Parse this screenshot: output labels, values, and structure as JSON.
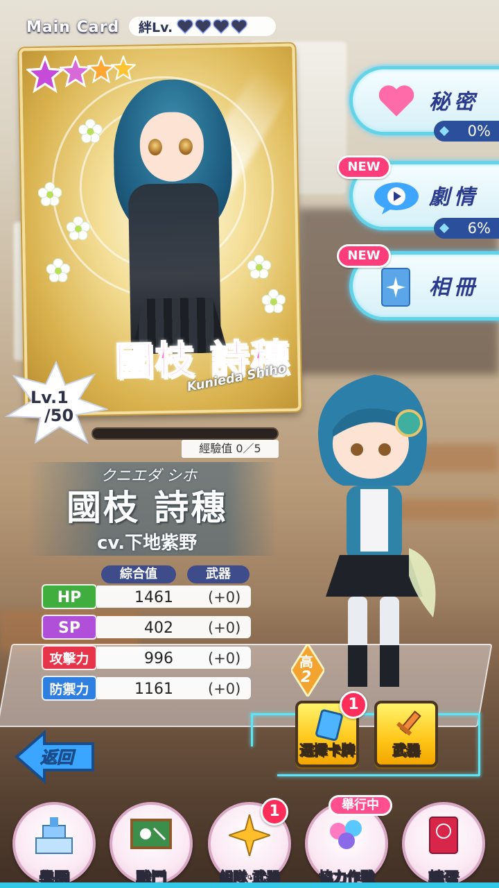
{
  "header": {
    "main_card_label": "Main Card",
    "bond_label": "絆Lv.",
    "bond_hearts": 4
  },
  "card": {
    "rarity_stars": 4,
    "name": "國枝 詩穗",
    "name_romaji": "Kunieda Shiho",
    "level_label": "Lv.1",
    "level_max": "/50",
    "exp_label": "經驗值 0／5",
    "exp_fraction": 0
  },
  "profile": {
    "kana": "クニエダ シホ",
    "name": "國枝 詩穗",
    "cv": "cv.下地紫野"
  },
  "stats": {
    "header_total": "綜合值",
    "header_weapon": "武器",
    "rows": [
      {
        "label": "HP",
        "value": "1461",
        "bonus": "(+0)",
        "color": "#3fae3f"
      },
      {
        "label": "SP",
        "value": "402",
        "bonus": "(+0)",
        "color": "#b04fd8"
      },
      {
        "label": "攻擊力",
        "value": "996",
        "bonus": "(+0)",
        "color": "#e6344a"
      },
      {
        "label": "防禦力",
        "value": "1161",
        "bonus": "(+0)",
        "color": "#2f7fe0"
      }
    ],
    "rank_top": "高",
    "rank_bottom": "2"
  },
  "side_menu": {
    "secret": {
      "label": "秘密",
      "percent": "0%"
    },
    "story": {
      "label": "劇情",
      "percent": "6%",
      "new_tag": "NEW"
    },
    "album": {
      "label": "相冊",
      "new_tag": "NEW"
    }
  },
  "actions": {
    "select_card": {
      "label": "選擇卡牌",
      "badge": "1"
    },
    "weapon": {
      "label": "武器"
    },
    "back": "返回"
  },
  "nav": {
    "items": [
      {
        "label": "學園",
        "icon": "school-icon"
      },
      {
        "label": "戰鬥",
        "icon": "battle-board-icon"
      },
      {
        "label": "組隊·武器",
        "icon": "team-star-icon",
        "badge": "1"
      },
      {
        "label": "協力作戰",
        "icon": "coop-balloon-icon",
        "event_tag": "舉行中"
      },
      {
        "label": "轉蛋",
        "icon": "gacha-ticket-icon"
      }
    ]
  },
  "colors": {
    "accent_cyan": "#5ee4f5",
    "new_pink": "#ff3d7a",
    "panel_navy": "#2a3a8c"
  }
}
